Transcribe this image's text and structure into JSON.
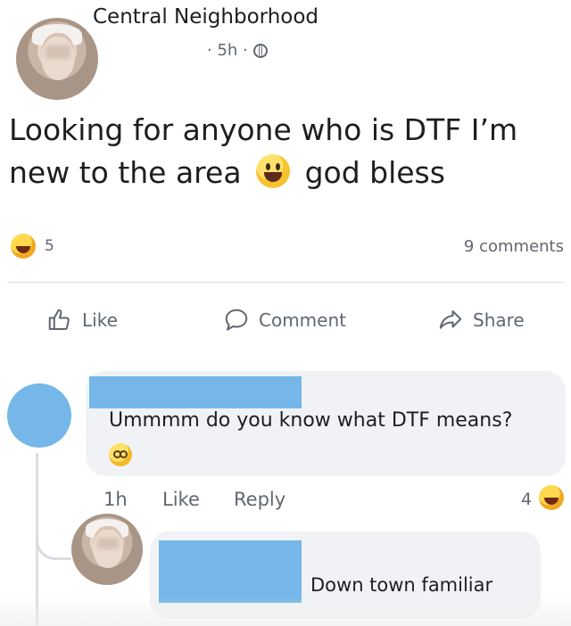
{
  "post": {
    "author": "Central Neighborhood",
    "time": "· 5h ·",
    "text_before": "Looking for anyone who is DTF I’m new to the area",
    "text_after": "god bless",
    "reaction_count": "5",
    "comments_count": "9 comments"
  },
  "actions": {
    "like": "Like",
    "comment": "Comment",
    "share": "Share"
  },
  "comments": [
    {
      "text": "Ummmm do you know what DTF means?",
      "time": "1h",
      "like_label": "Like",
      "reply_label": "Reply",
      "reaction_count": "4"
    },
    {
      "text": "Down town familiar"
    }
  ],
  "colors": {
    "redaction": "#74b7e8",
    "bubble": "#f0f2f5",
    "muted_text": "#606770"
  },
  "icons": [
    "globe-icon",
    "smiley-emoji-icon",
    "laughing-emoji-icon",
    "thumbs-up-icon",
    "comment-icon",
    "share-icon",
    "flushed-emoji-icon"
  ]
}
